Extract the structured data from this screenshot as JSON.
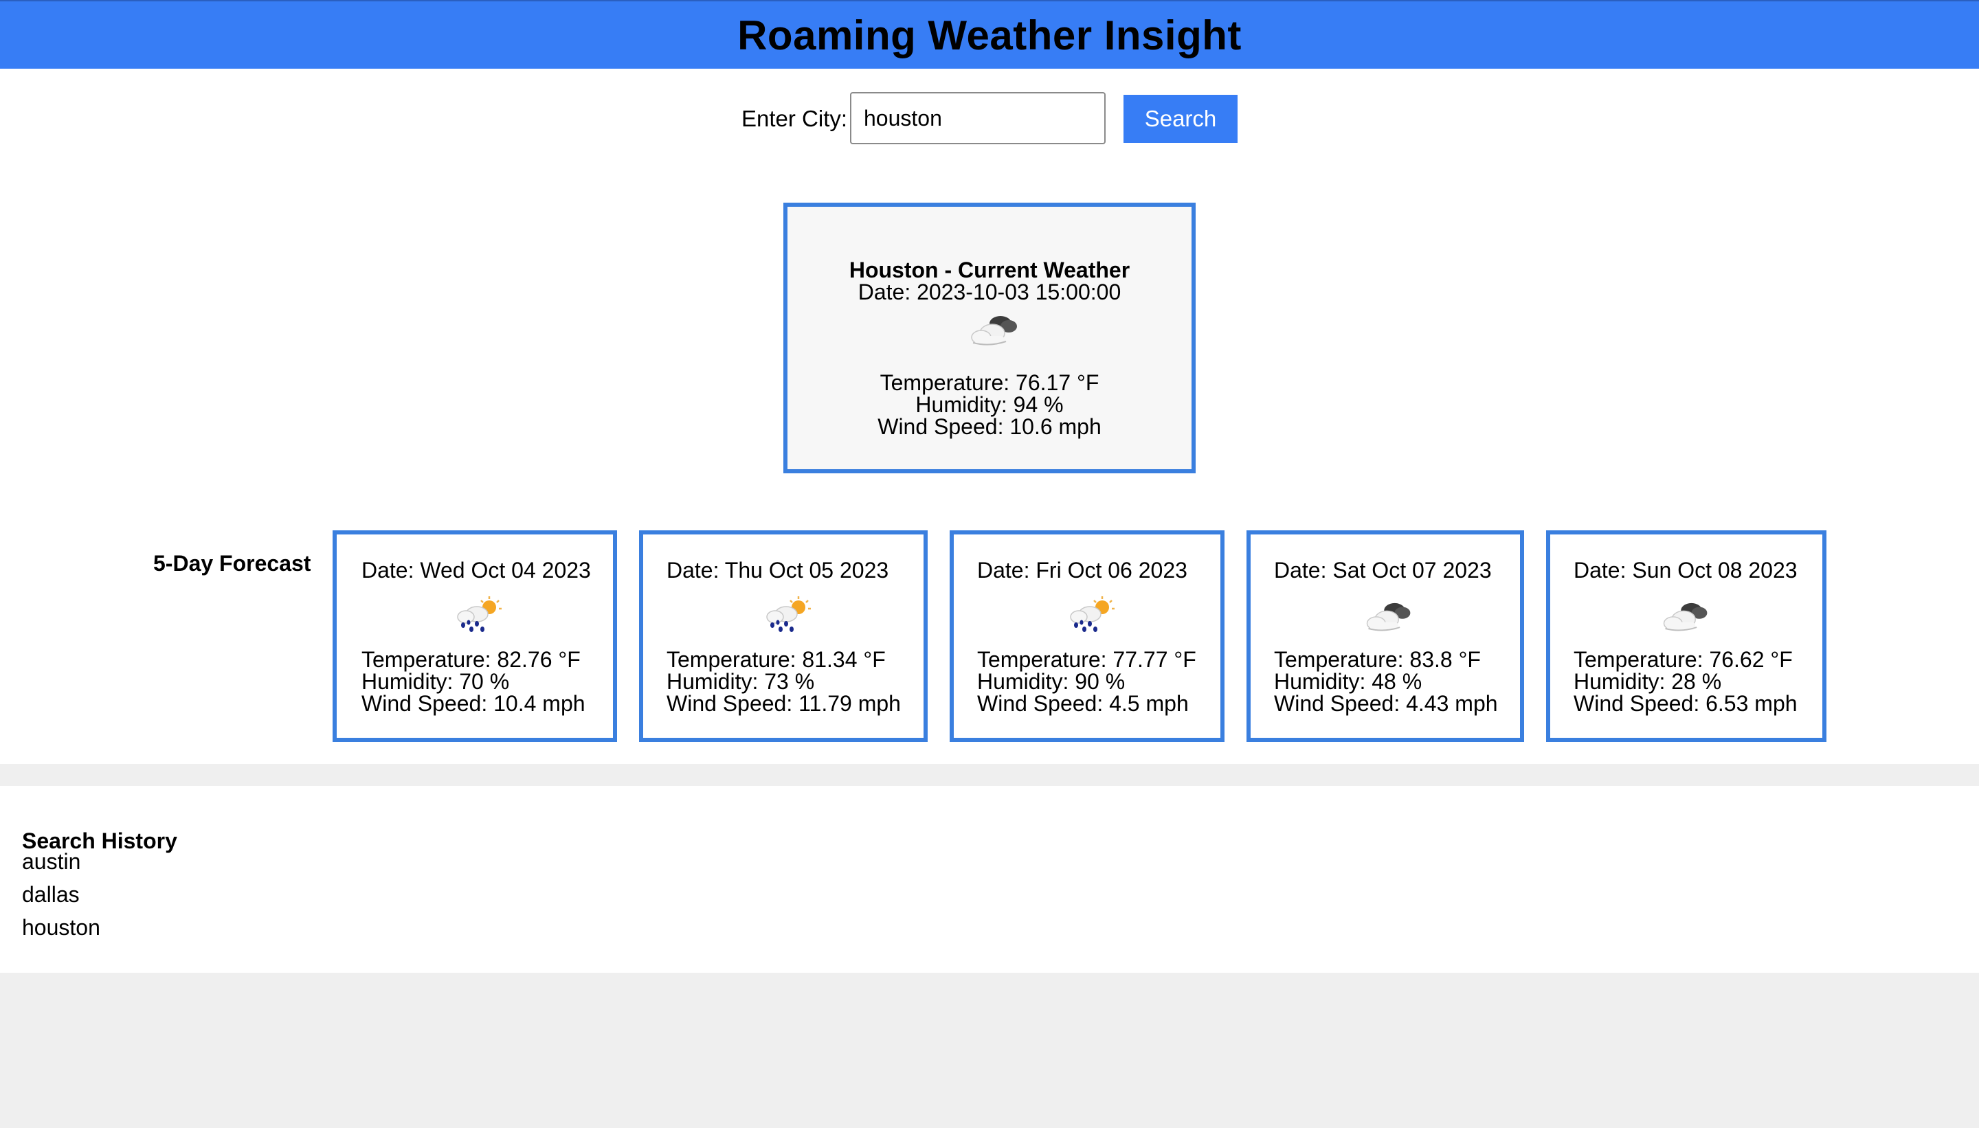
{
  "header": {
    "title": "Roaming Weather Insight"
  },
  "search": {
    "label": "Enter City:",
    "value": "houston",
    "button_label": "Search"
  },
  "current": {
    "title": "Houston - Current Weather",
    "date": "Date: 2023-10-03 15:00:00",
    "icon": "cloudy-icon",
    "temperature": "Temperature: 76.17 °F",
    "humidity": "Humidity: 94 %",
    "wind": "Wind Speed: 10.6 mph"
  },
  "forecast": {
    "label": "5-Day Forecast",
    "days": [
      {
        "date": "Date: Wed Oct 04 2023",
        "icon": "rain-sun-icon",
        "temperature": "Temperature: 82.76 °F",
        "humidity": "Humidity: 70 %",
        "wind": "Wind Speed: 10.4 mph"
      },
      {
        "date": "Date: Thu Oct 05 2023",
        "icon": "rain-sun-icon",
        "temperature": "Temperature: 81.34 °F",
        "humidity": "Humidity: 73 %",
        "wind": "Wind Speed: 11.79 mph"
      },
      {
        "date": "Date: Fri Oct 06 2023",
        "icon": "rain-sun-icon",
        "temperature": "Temperature: 77.77 °F",
        "humidity": "Humidity: 90 %",
        "wind": "Wind Speed: 4.5 mph"
      },
      {
        "date": "Date: Sat Oct 07 2023",
        "icon": "cloudy-icon",
        "temperature": "Temperature: 83.8 °F",
        "humidity": "Humidity: 48 %",
        "wind": "Wind Speed: 4.43 mph"
      },
      {
        "date": "Date: Sun Oct 08 2023",
        "icon": "cloudy-icon",
        "temperature": "Temperature: 76.62 °F",
        "humidity": "Humidity: 28 %",
        "wind": "Wind Speed: 6.53 mph"
      }
    ]
  },
  "history": {
    "title": "Search History",
    "items": [
      "austin",
      "dallas",
      "houston"
    ]
  },
  "colors": {
    "accent": "#377df5",
    "card_border": "#3a7fdf",
    "page_background": "#efefef"
  }
}
